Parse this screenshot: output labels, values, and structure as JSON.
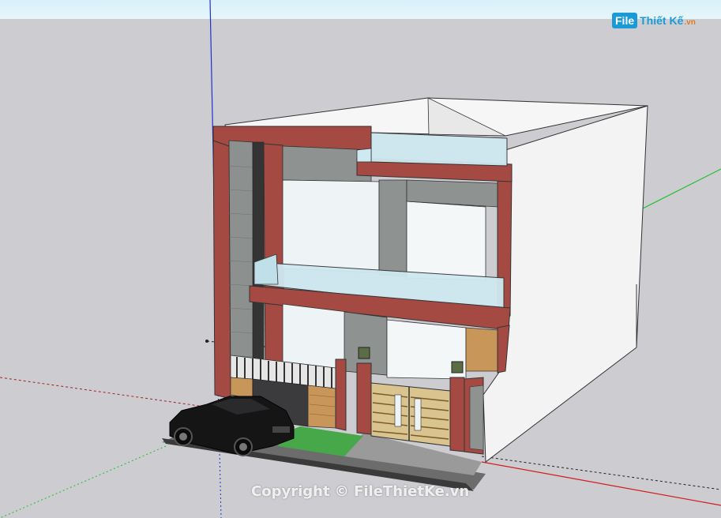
{
  "logo": {
    "badge": "File",
    "name": "Thiết Kế",
    "suffix": ".vn"
  },
  "watermark": "Copyright © FileThietKe.vn",
  "colors": {
    "sky": "#dff4fb",
    "ground": "#cfcfd3",
    "facade_red": "#a54a43",
    "wall_white": "#f2f2f2",
    "glass": "#cfe9f0",
    "grey_tile": "#8e9290",
    "wood": "#c9965a",
    "grass": "#47a84a"
  }
}
